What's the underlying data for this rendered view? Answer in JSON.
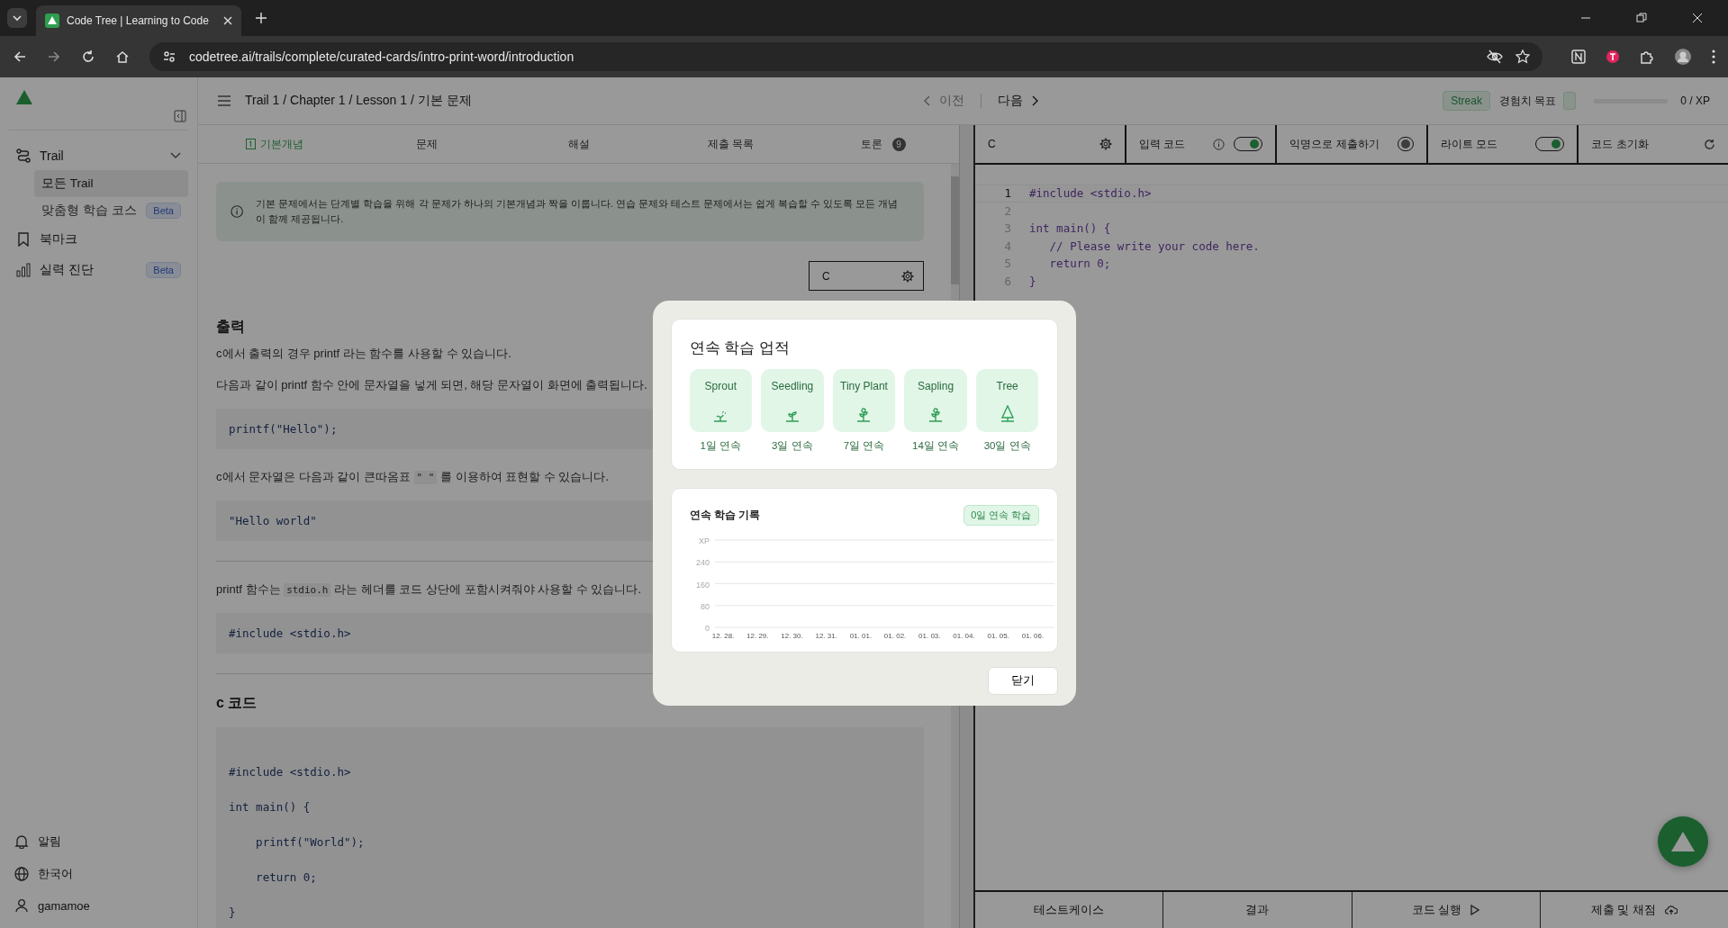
{
  "browser": {
    "tab_title": "Code Tree | Learning to Code",
    "url": "codetree.ai/trails/complete/curated-cards/intro-print-word/introduction"
  },
  "sidebar": {
    "items": [
      {
        "label": "Trail",
        "kind": "group",
        "expanded": true,
        "children": [
          {
            "label": "모든 Trail",
            "selected": true
          },
          {
            "label": "맞춤형 학습 코스",
            "badge": "Beta",
            "selected": false
          }
        ]
      },
      {
        "label": "북마크",
        "kind": "bookmark"
      },
      {
        "label": "실력 진단",
        "kind": "chart",
        "badge": "Beta"
      }
    ],
    "bottom": [
      {
        "label": "알림",
        "kind": "bell"
      },
      {
        "label": "한국어",
        "kind": "globe"
      },
      {
        "label": "gamamoe",
        "kind": "user"
      }
    ]
  },
  "header": {
    "breadcrumb": "Trail 1 / Chapter 1 / Lesson 1 / 기본 문제",
    "prev": "이전",
    "next": "다음",
    "streak": "Streak",
    "xp_goal": "경험치 목표",
    "xp": {
      "level": 0,
      "reading": "0 / XP"
    }
  },
  "tabs": [
    {
      "label": "기본개념",
      "selected": true
    },
    {
      "label": "문제",
      "selected": false
    },
    {
      "label": "해설",
      "selected": false
    },
    {
      "label": "제출 목록",
      "selected": false
    },
    {
      "label": "토론",
      "count": "9",
      "selected": false
    }
  ],
  "content": {
    "notice": "기본 문제에서는 단계별 학습을 위해 각 문제가 하나의 기본개념과 짝을 이룹니다. 연습 문제와 테스트 문제에서는 쉽게 복습할 수 있도록 모든 개념이 함께 제공됩니다.",
    "language": "C",
    "blocks": [
      {
        "kind": "heading",
        "text": "출력"
      },
      {
        "kind": "paragraph",
        "parts": [
          {
            "text": "c에서 출력의 경우 printf 라는 함수를 사용할 수 있습니다."
          }
        ]
      },
      {
        "kind": "paragraph",
        "parts": [
          {
            "text": "다음과 같이 printf 함수 안에 문자열을 넣게 되면, 해당 문자열이 화면에 출력됩니다."
          }
        ]
      },
      {
        "kind": "code",
        "lines": [
          "printf(\"Hello\");"
        ]
      },
      {
        "kind": "paragraph",
        "parts": [
          {
            "text": "c에서 문자열은 다음과 같이 큰따옴표 "
          },
          {
            "code": "\" \""
          },
          {
            "text": " 를 이용하여 표현할 수 있습니다."
          }
        ]
      },
      {
        "kind": "code",
        "lines": [
          "\"Hello world\""
        ]
      },
      {
        "kind": "divider"
      },
      {
        "kind": "paragraph",
        "parts": [
          {
            "text": "printf 함수는 "
          },
          {
            "code": "stdio.h"
          },
          {
            "text": " 라는 헤더를 코드 상단에 포함시켜줘야 사용할 수 있습니다."
          }
        ]
      },
      {
        "kind": "code",
        "lines": [
          "#include <stdio.h>"
        ]
      },
      {
        "kind": "divider"
      },
      {
        "kind": "heading",
        "text": "c 코드"
      },
      {
        "kind": "bigcode",
        "lines": [
          "#include <stdio.h>",
          "int main() {",
          "    printf(\"World\");",
          "    return 0;",
          "}"
        ]
      }
    ]
  },
  "editor": {
    "language": "C",
    "toggles": [
      {
        "label": "입력 코드",
        "info": true,
        "on": true
      },
      {
        "label": "익명으로 제출하기",
        "info": false,
        "on": false
      },
      {
        "label": "라이트 모드",
        "info": false,
        "on": true
      }
    ],
    "reset": "코드 초기화",
    "lines": [
      {
        "number": "1",
        "code": "#include <stdio.h>",
        "selected": true
      },
      {
        "number": "2",
        "selected": false
      },
      {
        "number": "3",
        "code": "int main() {",
        "selected": false
      },
      {
        "number": "4",
        "code": "   // Please write your code here.",
        "selected": false
      },
      {
        "number": "5",
        "code": "   return 0;",
        "selected": false
      },
      {
        "number": "6",
        "code": "}",
        "selected": false
      }
    ],
    "bottom_tabs": [
      {
        "label": "테스트케이스",
        "kind": "plain"
      },
      {
        "label": "결과",
        "kind": "plain"
      },
      {
        "label": "코드 실행",
        "kind": "run"
      },
      {
        "label": "제출 및 채점",
        "kind": "submit"
      }
    ]
  },
  "modal": {
    "title": "연속 학습 업적",
    "badges": [
      {
        "name": "Sprout",
        "streak": "1일 연속"
      },
      {
        "name": "Seedling",
        "streak": "3일 연속"
      },
      {
        "name": "Tiny Plant",
        "streak": "7일 연속"
      },
      {
        "name": "Sapling",
        "streak": "14일 연속"
      },
      {
        "name": "Tree",
        "streak": "30일 연속"
      }
    ],
    "history_title": "연속 학습 기록",
    "history_badge": "0일 연속 학습",
    "chart_data": {
      "type": "bar",
      "ylabel": "XP",
      "categories": [
        "12. 28.",
        "12. 29.",
        "12. 30.",
        "12. 31.",
        "01. 01.",
        "01. 02.",
        "01. 03.",
        "01. 04.",
        "01. 05.",
        "01. 06."
      ],
      "values": [
        0,
        0,
        0,
        0,
        0,
        0,
        0,
        0,
        0,
        0
      ],
      "ylim": [
        0,
        320
      ],
      "yticks": [
        0,
        80,
        160,
        240
      ],
      "grid": true
    },
    "close": "닫기"
  }
}
